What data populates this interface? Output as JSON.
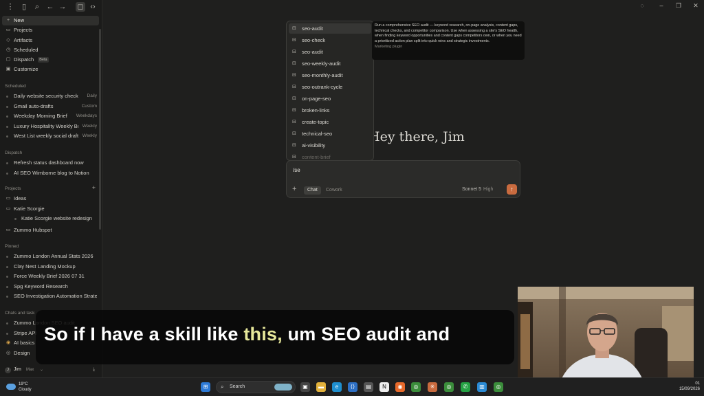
{
  "sidebar": {
    "nav": [
      {
        "label": "New",
        "icon": "plus-icon"
      },
      {
        "label": "Projects",
        "icon": "folder-icon"
      },
      {
        "label": "Artifacts",
        "icon": "artifact-icon"
      },
      {
        "label": "Scheduled",
        "icon": "clock-icon"
      },
      {
        "label": "Dispatch",
        "icon": "dispatch-icon",
        "badge": "Beta"
      },
      {
        "label": "Customize",
        "icon": "customize-icon"
      }
    ],
    "scheduled": {
      "label": "Scheduled",
      "items": [
        {
          "title": "Daily website security check",
          "freq": "Daily"
        },
        {
          "title": "Gmail auto-drafts",
          "freq": "Custom"
        },
        {
          "title": "Weekday Morning Brief",
          "freq": "Weekdays"
        },
        {
          "title": "Luxury Hospitality Weekly Br",
          "freq": "Weekly"
        },
        {
          "title": "West List weekly social drafts",
          "freq": "Weekly"
        }
      ]
    },
    "dispatch": {
      "label": "Dispatch",
      "items": [
        "Refresh status dashboard now",
        "AI SEO Wimborne blog to Notion"
      ]
    },
    "projects": {
      "label": "Projects",
      "items": [
        "Ideas",
        "Katie Scorgie",
        "Katie Scorgie website redesign",
        "Zummo Hubspot"
      ]
    },
    "pinned": {
      "label": "Pinned",
      "items": [
        "Zummo London Annual Stats 2026",
        "Clay Nest Landing Mockup",
        "Force Weekly Brief 2026 07 31",
        "Spg Keyword Research",
        "SEO Investigation Automation Strategy"
      ]
    },
    "chats": {
      "label": "Chats and task",
      "items": [
        "Zummo London SEO audit",
        "Stripe API",
        "AI basics",
        "Design"
      ]
    },
    "user": {
      "name": "Jim",
      "plan": "Max",
      "initial": "J"
    }
  },
  "skills_menu": {
    "items": [
      "seo-audit",
      "seo-check",
      "seo-audit",
      "seo-weekly-audit",
      "seo-monthly-audit",
      "seo-outrank-cycle",
      "on-page-seo",
      "broken-links",
      "create-topic",
      "technical-seo",
      "ai-visibility",
      "content-brief"
    ],
    "selected_index": 0,
    "tooltip": {
      "description": "Run a comprehensive SEO audit — keyword research, on-page analysis, content gaps, technical checks, and competitor comparison. Use when assessing a site's SEO health, when finding keyword opportunities and content gaps competitors own, or when you need a prioritized action plan split into quick wins and strategic investments.",
      "source": "Marketing plugin"
    }
  },
  "main": {
    "greeting": "Hey there, Jim",
    "composer": {
      "input_value": "/se",
      "modes": [
        "Chat",
        "Cowork"
      ],
      "active_mode": "Chat",
      "model": "Sonnet 5",
      "effort": "High"
    }
  },
  "caption": {
    "before": "So if I have a skill like ",
    "highlight": "this,",
    "after": " um SEO audit and",
    "highlight_color": "#e6e79a"
  },
  "taskbar": {
    "weather": {
      "temp": "19°C",
      "condition": "Cloudy"
    },
    "search_label": "Search",
    "date": "15/09/2026",
    "time": "01"
  },
  "colors": {
    "background": "#1f1f1e",
    "sidebar": "#1b1b1a",
    "send_button": "#c96b3f",
    "tooltip_bg": "#0f0f0e"
  }
}
